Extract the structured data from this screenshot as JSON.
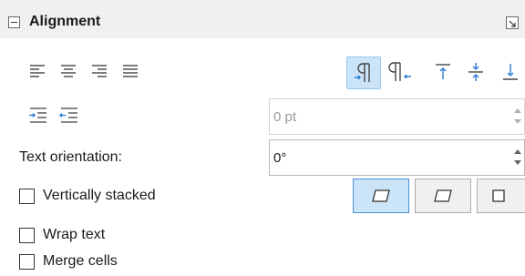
{
  "panel": {
    "title": "Alignment"
  },
  "horizontal_align": [
    "align-left-icon",
    "align-center-icon",
    "align-right-icon",
    "justify-icon"
  ],
  "vertical_align": [
    "text-direction-ltr-icon",
    "text-direction-rtl-icon",
    "align-top-icon",
    "align-middle-icon",
    "align-bottom-icon"
  ],
  "indent": {
    "buttons": [
      "increase-indent-icon",
      "decrease-indent-icon"
    ],
    "value": "0 pt"
  },
  "orientation": {
    "label": "Text orientation:",
    "value": "0°"
  },
  "options": {
    "vertically_stacked": "Vertically stacked",
    "wrap_text": "Wrap text",
    "merge_cells": "Merge cells"
  },
  "orientation_buttons": [
    "slanted-left-icon",
    "slanted-right-icon",
    "square-icon"
  ],
  "colors": {
    "accent": "#2b7cd3",
    "active_bg": "#cce4f7"
  }
}
